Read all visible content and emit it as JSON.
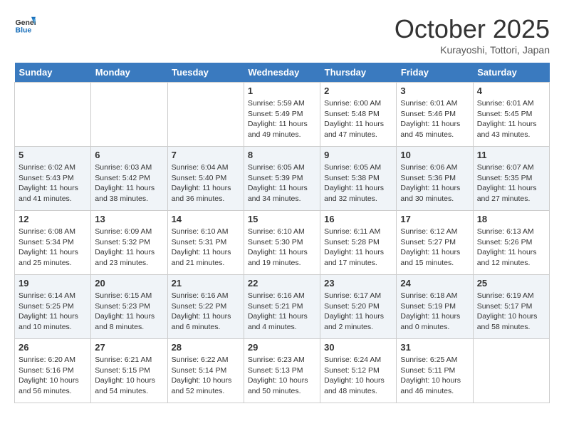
{
  "header": {
    "logo_general": "General",
    "logo_blue": "Blue",
    "month": "October 2025",
    "location": "Kurayoshi, Tottori, Japan"
  },
  "days_of_week": [
    "Sunday",
    "Monday",
    "Tuesday",
    "Wednesday",
    "Thursday",
    "Friday",
    "Saturday"
  ],
  "weeks": [
    [
      {
        "day": "",
        "sunrise": "",
        "sunset": "",
        "daylight": ""
      },
      {
        "day": "",
        "sunrise": "",
        "sunset": "",
        "daylight": ""
      },
      {
        "day": "",
        "sunrise": "",
        "sunset": "",
        "daylight": ""
      },
      {
        "day": "1",
        "sunrise": "Sunrise: 5:59 AM",
        "sunset": "Sunset: 5:49 PM",
        "daylight": "Daylight: 11 hours and 49 minutes."
      },
      {
        "day": "2",
        "sunrise": "Sunrise: 6:00 AM",
        "sunset": "Sunset: 5:48 PM",
        "daylight": "Daylight: 11 hours and 47 minutes."
      },
      {
        "day": "3",
        "sunrise": "Sunrise: 6:01 AM",
        "sunset": "Sunset: 5:46 PM",
        "daylight": "Daylight: 11 hours and 45 minutes."
      },
      {
        "day": "4",
        "sunrise": "Sunrise: 6:01 AM",
        "sunset": "Sunset: 5:45 PM",
        "daylight": "Daylight: 11 hours and 43 minutes."
      }
    ],
    [
      {
        "day": "5",
        "sunrise": "Sunrise: 6:02 AM",
        "sunset": "Sunset: 5:43 PM",
        "daylight": "Daylight: 11 hours and 41 minutes."
      },
      {
        "day": "6",
        "sunrise": "Sunrise: 6:03 AM",
        "sunset": "Sunset: 5:42 PM",
        "daylight": "Daylight: 11 hours and 38 minutes."
      },
      {
        "day": "7",
        "sunrise": "Sunrise: 6:04 AM",
        "sunset": "Sunset: 5:40 PM",
        "daylight": "Daylight: 11 hours and 36 minutes."
      },
      {
        "day": "8",
        "sunrise": "Sunrise: 6:05 AM",
        "sunset": "Sunset: 5:39 PM",
        "daylight": "Daylight: 11 hours and 34 minutes."
      },
      {
        "day": "9",
        "sunrise": "Sunrise: 6:05 AM",
        "sunset": "Sunset: 5:38 PM",
        "daylight": "Daylight: 11 hours and 32 minutes."
      },
      {
        "day": "10",
        "sunrise": "Sunrise: 6:06 AM",
        "sunset": "Sunset: 5:36 PM",
        "daylight": "Daylight: 11 hours and 30 minutes."
      },
      {
        "day": "11",
        "sunrise": "Sunrise: 6:07 AM",
        "sunset": "Sunset: 5:35 PM",
        "daylight": "Daylight: 11 hours and 27 minutes."
      }
    ],
    [
      {
        "day": "12",
        "sunrise": "Sunrise: 6:08 AM",
        "sunset": "Sunset: 5:34 PM",
        "daylight": "Daylight: 11 hours and 25 minutes."
      },
      {
        "day": "13",
        "sunrise": "Sunrise: 6:09 AM",
        "sunset": "Sunset: 5:32 PM",
        "daylight": "Daylight: 11 hours and 23 minutes."
      },
      {
        "day": "14",
        "sunrise": "Sunrise: 6:10 AM",
        "sunset": "Sunset: 5:31 PM",
        "daylight": "Daylight: 11 hours and 21 minutes."
      },
      {
        "day": "15",
        "sunrise": "Sunrise: 6:10 AM",
        "sunset": "Sunset: 5:30 PM",
        "daylight": "Daylight: 11 hours and 19 minutes."
      },
      {
        "day": "16",
        "sunrise": "Sunrise: 6:11 AM",
        "sunset": "Sunset: 5:28 PM",
        "daylight": "Daylight: 11 hours and 17 minutes."
      },
      {
        "day": "17",
        "sunrise": "Sunrise: 6:12 AM",
        "sunset": "Sunset: 5:27 PM",
        "daylight": "Daylight: 11 hours and 15 minutes."
      },
      {
        "day": "18",
        "sunrise": "Sunrise: 6:13 AM",
        "sunset": "Sunset: 5:26 PM",
        "daylight": "Daylight: 11 hours and 12 minutes."
      }
    ],
    [
      {
        "day": "19",
        "sunrise": "Sunrise: 6:14 AM",
        "sunset": "Sunset: 5:25 PM",
        "daylight": "Daylight: 11 hours and 10 minutes."
      },
      {
        "day": "20",
        "sunrise": "Sunrise: 6:15 AM",
        "sunset": "Sunset: 5:23 PM",
        "daylight": "Daylight: 11 hours and 8 minutes."
      },
      {
        "day": "21",
        "sunrise": "Sunrise: 6:16 AM",
        "sunset": "Sunset: 5:22 PM",
        "daylight": "Daylight: 11 hours and 6 minutes."
      },
      {
        "day": "22",
        "sunrise": "Sunrise: 6:16 AM",
        "sunset": "Sunset: 5:21 PM",
        "daylight": "Daylight: 11 hours and 4 minutes."
      },
      {
        "day": "23",
        "sunrise": "Sunrise: 6:17 AM",
        "sunset": "Sunset: 5:20 PM",
        "daylight": "Daylight: 11 hours and 2 minutes."
      },
      {
        "day": "24",
        "sunrise": "Sunrise: 6:18 AM",
        "sunset": "Sunset: 5:19 PM",
        "daylight": "Daylight: 11 hours and 0 minutes."
      },
      {
        "day": "25",
        "sunrise": "Sunrise: 6:19 AM",
        "sunset": "Sunset: 5:17 PM",
        "daylight": "Daylight: 10 hours and 58 minutes."
      }
    ],
    [
      {
        "day": "26",
        "sunrise": "Sunrise: 6:20 AM",
        "sunset": "Sunset: 5:16 PM",
        "daylight": "Daylight: 10 hours and 56 minutes."
      },
      {
        "day": "27",
        "sunrise": "Sunrise: 6:21 AM",
        "sunset": "Sunset: 5:15 PM",
        "daylight": "Daylight: 10 hours and 54 minutes."
      },
      {
        "day": "28",
        "sunrise": "Sunrise: 6:22 AM",
        "sunset": "Sunset: 5:14 PM",
        "daylight": "Daylight: 10 hours and 52 minutes."
      },
      {
        "day": "29",
        "sunrise": "Sunrise: 6:23 AM",
        "sunset": "Sunset: 5:13 PM",
        "daylight": "Daylight: 10 hours and 50 minutes."
      },
      {
        "day": "30",
        "sunrise": "Sunrise: 6:24 AM",
        "sunset": "Sunset: 5:12 PM",
        "daylight": "Daylight: 10 hours and 48 minutes."
      },
      {
        "day": "31",
        "sunrise": "Sunrise: 6:25 AM",
        "sunset": "Sunset: 5:11 PM",
        "daylight": "Daylight: 10 hours and 46 minutes."
      },
      {
        "day": "",
        "sunrise": "",
        "sunset": "",
        "daylight": ""
      }
    ]
  ]
}
